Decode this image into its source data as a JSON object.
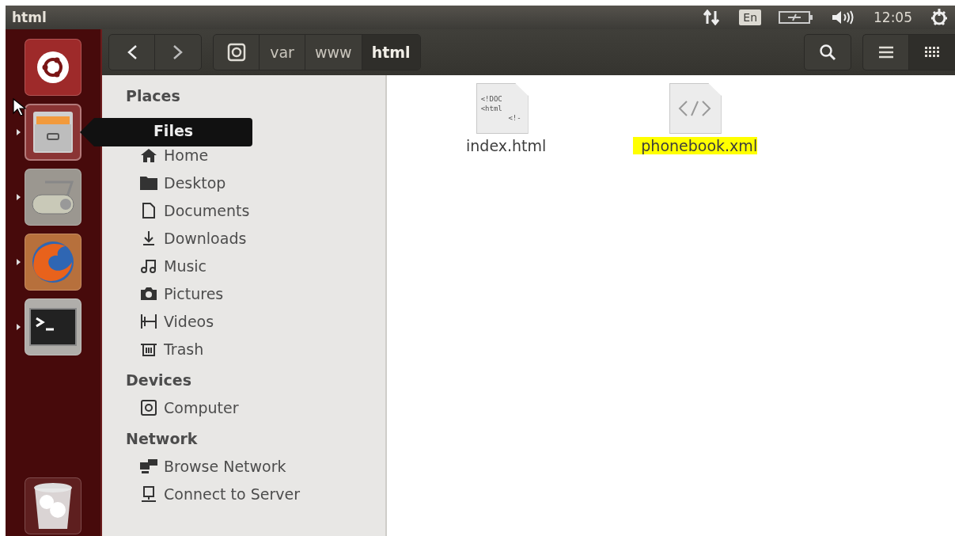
{
  "window": {
    "title": "html"
  },
  "panel": {
    "keyboard": "En",
    "clock": "12:05"
  },
  "launcher": {
    "items": [
      {
        "kind": "dash",
        "running": false,
        "focused": false
      },
      {
        "kind": "files",
        "running": true,
        "focused": true
      },
      {
        "kind": "scanner",
        "running": true,
        "focused": false
      },
      {
        "kind": "browser",
        "running": true,
        "focused": false
      },
      {
        "kind": "terminal",
        "running": true,
        "focused": false
      }
    ],
    "trash": {
      "kind": "trash"
    },
    "tooltip": "Files"
  },
  "toolbar": {
    "path": [
      {
        "kind": "drive",
        "selected": false
      },
      {
        "kind": "folder",
        "label": "var",
        "selected": false
      },
      {
        "kind": "folder",
        "label": "www",
        "selected": false
      },
      {
        "kind": "folder",
        "label": "html",
        "selected": true
      }
    ],
    "views": [
      {
        "kind": "list",
        "selected": false
      },
      {
        "kind": "grid",
        "selected": true
      }
    ]
  },
  "sidebar": {
    "sections": [
      {
        "title": "Places",
        "items": [
          {
            "kind": "home",
            "label": "Home"
          },
          {
            "kind": "desktop",
            "label": "Desktop"
          },
          {
            "kind": "documents",
            "label": "Documents"
          },
          {
            "kind": "downloads",
            "label": "Downloads"
          },
          {
            "kind": "music",
            "label": "Music"
          },
          {
            "kind": "pictures",
            "label": "Pictures"
          },
          {
            "kind": "videos",
            "label": "Videos"
          },
          {
            "kind": "trash",
            "label": "Trash"
          }
        ]
      },
      {
        "title": "Devices",
        "items": [
          {
            "kind": "computer",
            "label": "Computer"
          }
        ]
      },
      {
        "title": "Network",
        "items": [
          {
            "kind": "network",
            "label": "Browse Network"
          },
          {
            "kind": "server",
            "label": "Connect to Server"
          }
        ]
      }
    ]
  },
  "files": [
    {
      "kind": "html",
      "name": "index.html",
      "preview": [
        "<!DOC",
        "<html",
        "<!-"
      ],
      "highlighted": false
    },
    {
      "kind": "xml",
      "name": "phonebook.xml",
      "highlighted": true
    }
  ]
}
